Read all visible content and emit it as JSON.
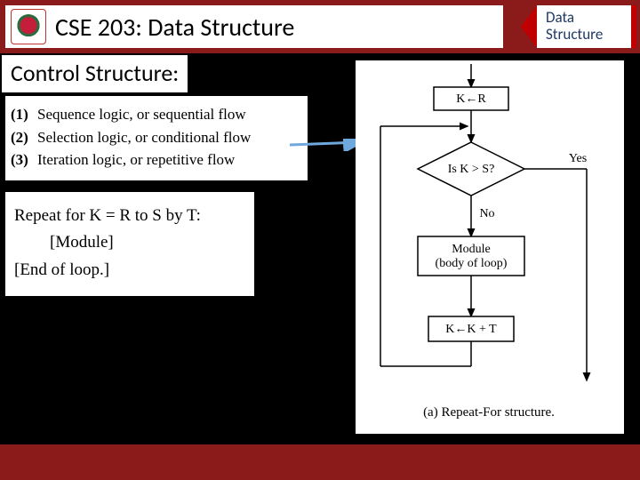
{
  "header": {
    "course_title": "CSE 203: Data Structure",
    "badge_line1": "Data",
    "badge_line2": "Structure"
  },
  "section": {
    "title": "Control Structure:"
  },
  "logic": {
    "items": [
      {
        "num": "(1)",
        "text": "Sequence logic, or sequential flow"
      },
      {
        "num": "(2)",
        "text": "Selection logic, or conditional flow"
      },
      {
        "num": "(3)",
        "text": "Iteration logic, or repetitive flow"
      }
    ]
  },
  "pseudo": {
    "line1": "Repeat for K = R to S by T:",
    "line2": "[Module]",
    "line3": "[End of loop.]"
  },
  "flow": {
    "init": "K←R",
    "decision": "Is K > S?",
    "yes": "Yes",
    "no": "No",
    "module_l1": "Module",
    "module_l2": "(body of loop)",
    "incr": "K←K + T",
    "caption": "(a) Repeat-For structure."
  }
}
